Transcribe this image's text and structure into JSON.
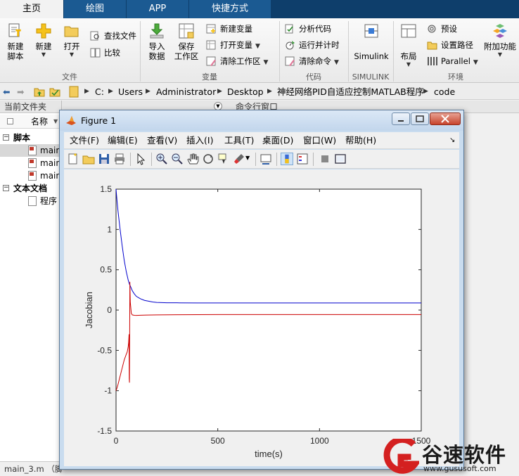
{
  "tabs": [
    {
      "label": "主页"
    },
    {
      "label": "绘图"
    },
    {
      "label": "APP"
    },
    {
      "label": "快捷方式"
    }
  ],
  "ribbon": {
    "file": {
      "new_script": [
        "新建",
        "脚本"
      ],
      "new": "新建",
      "open": "打开",
      "find_files": "查找文件",
      "compare": "比较",
      "group": "文件"
    },
    "variable": {
      "import": [
        "导入",
        "数据"
      ],
      "save": [
        "保存",
        "工作区"
      ],
      "new_var": "新建变量",
      "open_var": "打开变量",
      "clear_ws": "清除工作区",
      "group": "变量"
    },
    "code": {
      "analyze": "分析代码",
      "run_time": "运行并计时",
      "clear_cmd": "清除命令",
      "group": "代码"
    },
    "simulink": {
      "label": "Simulink",
      "group": "SIMULINK"
    },
    "env": {
      "layout": "布局",
      "prefs": "预设",
      "setpath": "设置路径",
      "parallel": "Parallel",
      "addons": "附加功能",
      "group": "环境"
    }
  },
  "address": {
    "path": [
      "C:",
      "Users",
      "Administrator",
      "Desktop",
      "神经网络PID自适应控制MATLAB程序",
      "code"
    ]
  },
  "left_panel": {
    "title": "当前文件夹",
    "col_name": "名称",
    "group_scripts": "脚本",
    "files": [
      "main",
      "main",
      "main"
    ],
    "group_text": "文本文档",
    "text_file": "程序"
  },
  "status": "main_3.m （脚",
  "cmd_title": "命令行窗口",
  "figure": {
    "title": "Figure 1",
    "menu": [
      "文件(F)",
      "编辑(E)",
      "查看(V)",
      "插入(I)",
      "工具(T)",
      "桌面(D)",
      "窗口(W)",
      "帮助(H)"
    ]
  },
  "chart_data": {
    "type": "line",
    "title": "",
    "xlabel": "time(s)",
    "ylabel": "Jacobian",
    "xlim": [
      0,
      1500
    ],
    "ylim": [
      -1.5,
      1.5
    ],
    "xticks": [
      "0",
      "500",
      "1000",
      "1500"
    ],
    "yticks": [
      "-1.5",
      "-1",
      "-0.5",
      "0",
      "0.5",
      "1",
      "1.5"
    ],
    "grid": false,
    "legend": "none",
    "series": [
      {
        "color": "#0000cc",
        "x": [
          0,
          5,
          10,
          20,
          30,
          40,
          50,
          60,
          66,
          70,
          75,
          80,
          90,
          100,
          120,
          140,
          160,
          180,
          200,
          250,
          300,
          400,
          500,
          800,
          1000,
          1200,
          1500
        ],
        "y": [
          1.5,
          1.35,
          1.22,
          1.0,
          0.8,
          0.62,
          0.48,
          0.37,
          0.32,
          0.3,
          0.27,
          0.24,
          0.2,
          0.17,
          0.14,
          0.12,
          0.11,
          0.1,
          0.095,
          0.09,
          0.09,
          0.088,
          0.088,
          0.088,
          0.088,
          0.088,
          0.088
        ]
      },
      {
        "color": "#cc0000",
        "x": [
          0,
          3,
          10,
          20,
          30,
          40,
          50,
          55,
          60,
          62,
          64,
          65,
          66,
          67,
          68,
          70,
          75,
          80,
          90,
          100,
          120,
          150,
          200,
          300,
          500,
          800,
          1000,
          1200,
          1500
        ],
        "y": [
          -1.0,
          -0.98,
          -0.92,
          -0.82,
          -0.72,
          -0.62,
          -0.55,
          -0.52,
          -0.45,
          -0.4,
          -0.3,
          -0.85,
          -0.9,
          -0.3,
          0.35,
          0.1,
          -0.04,
          -0.06,
          -0.065,
          -0.066,
          -0.064,
          -0.062,
          -0.06,
          -0.058,
          -0.056,
          -0.056,
          -0.056,
          -0.056,
          -0.056
        ]
      }
    ]
  },
  "watermark": {
    "brand": "谷速软件",
    "url": "www.gususoft.com",
    "color": "#d42020"
  }
}
